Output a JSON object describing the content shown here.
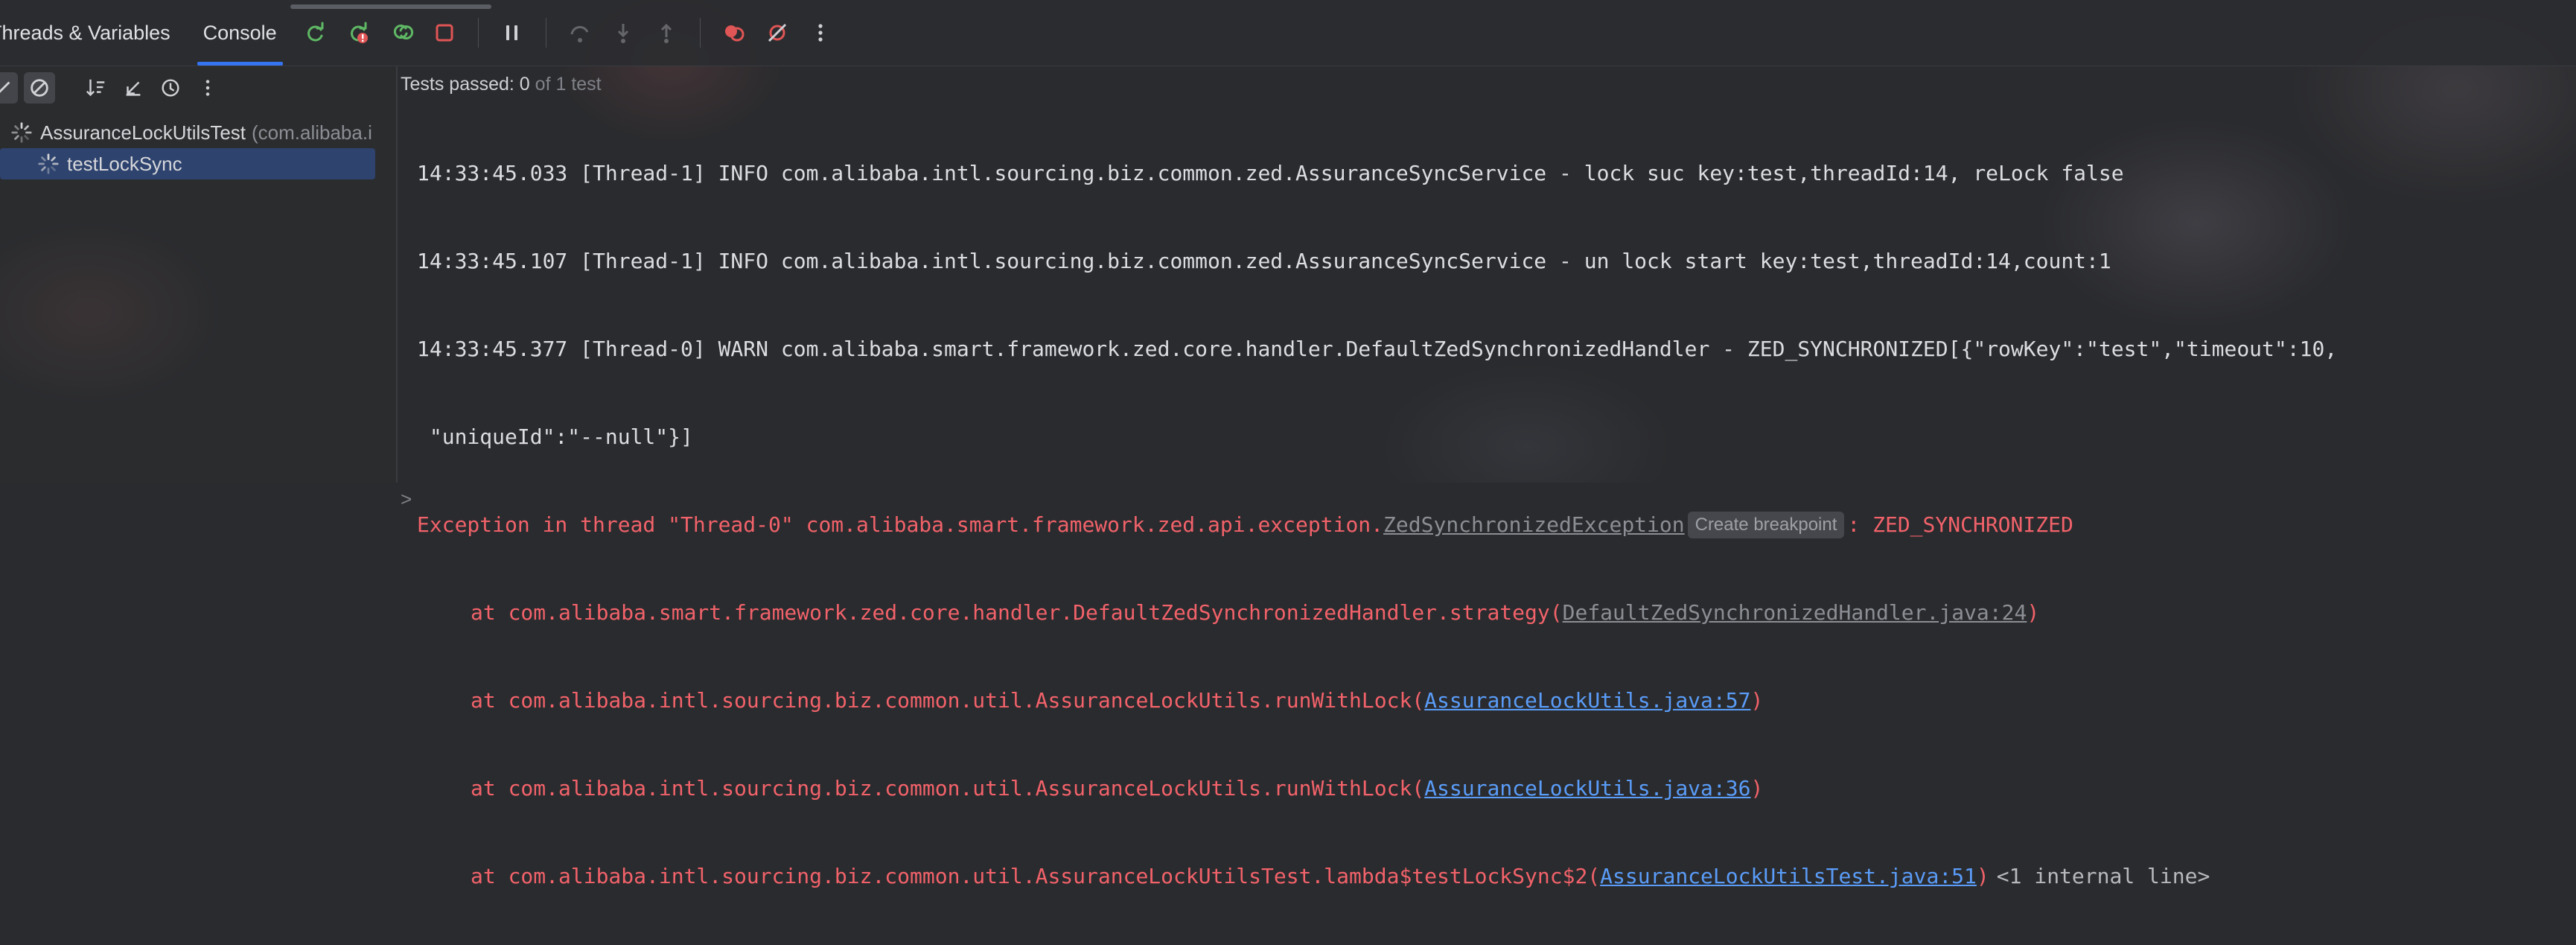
{
  "tabs": [
    {
      "label": "Threads & Variables",
      "active": false
    },
    {
      "label": "Console",
      "active": true
    }
  ],
  "colors": {
    "accent": "#3574f0",
    "error": "#f2626a",
    "link": "#5a9cf8",
    "rerun_green": "#5fb865",
    "stop_red": "#e05555"
  },
  "toolbar_icons": [
    "rerun-icon",
    "rerun-failed-icon",
    "toggle-auto-test-icon",
    "stop-icon",
    "pause-icon",
    "step-over-icon",
    "step-into-icon",
    "step-out-icon",
    "view-breakpoints-icon",
    "mute-breakpoints-icon",
    "more-icon"
  ],
  "left": {
    "toolbar_icons": [
      "show-passed-icon",
      "show-ignored-icon",
      "sort-alpha-icon",
      "sort-duration-icon",
      "history-icon",
      "more-icon"
    ],
    "tree": [
      {
        "label": "AssuranceLockUtilsTest",
        "pkg": "(com.alibaba.i",
        "level": 0
      },
      {
        "label": "testLockSync",
        "level": 1,
        "selected": true
      }
    ]
  },
  "status": {
    "label": "Tests passed: 0",
    "suffix": "of 1 test"
  },
  "console": {
    "line1": "14:33:45.033 [Thread-1] INFO com.alibaba.intl.sourcing.biz.common.zed.AssuranceSyncService - lock suc key:test,threadId:14, reLock false",
    "line2": "14:33:45.107 [Thread-1] INFO com.alibaba.intl.sourcing.biz.common.zed.AssuranceSyncService - un lock start key:test,threadId:14,count:1",
    "line3": "14:33:45.377 [Thread-0] WARN com.alibaba.smart.framework.zed.core.handler.DefaultZedSynchronizedHandler - ZED_SYNCHRONIZED[{\"rowKey\":\"test\",\"timeout\":10,",
    "line4": " \"uniqueId\":\"--null\"}]",
    "exc_prefix": "Exception in thread \"Thread-0\" com.alibaba.smart.framework.zed.api.exception.",
    "exc_class": "ZedSynchronizedException",
    "create_breakpoint": "Create breakpoint",
    "exc_suffix": ": ZED_SYNCHRONIZED",
    "frames": [
      {
        "prefix": "at com.alibaba.smart.framework.zed.core.handler.DefaultZedSynchronizedHandler.strategy(",
        "link": "DefaultZedSynchronizedHandler.java:24",
        "suffix": ")",
        "link_style": "grey"
      },
      {
        "prefix": "at com.alibaba.intl.sourcing.biz.common.util.AssuranceLockUtils.runWithLock(",
        "link": "AssuranceLockUtils.java:57",
        "suffix": ")",
        "link_style": "blue"
      },
      {
        "prefix": "at com.alibaba.intl.sourcing.biz.common.util.AssuranceLockUtils.runWithLock(",
        "link": "AssuranceLockUtils.java:36",
        "suffix": ")",
        "link_style": "blue"
      },
      {
        "prefix": "at com.alibaba.intl.sourcing.biz.common.util.AssuranceLockUtilsTest.lambda$testLockSync$2(",
        "link": "AssuranceLockUtilsTest.java:51",
        "suffix": ")",
        "link_style": "blue"
      }
    ],
    "internal_line": "<1 internal line>",
    "fold_chevron": ">"
  }
}
